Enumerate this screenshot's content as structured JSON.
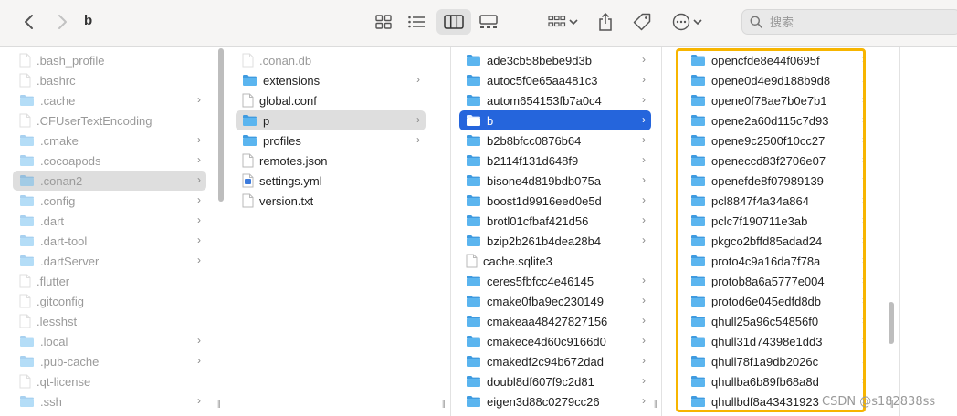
{
  "window": {
    "title": "b"
  },
  "toolbar": {
    "search_placeholder": "搜索"
  },
  "watermark": "CSDN @s182838ss",
  "col1": [
    {
      "label": ".bash_profile",
      "type": "doc",
      "hidden": true
    },
    {
      "label": ".bashrc",
      "type": "doc",
      "hidden": true
    },
    {
      "label": ".cache",
      "type": "folder",
      "hidden": true,
      "chevron": true
    },
    {
      "label": ".CFUserTextEncoding",
      "type": "doc",
      "hidden": true
    },
    {
      "label": ".cmake",
      "type": "folder",
      "hidden": true,
      "chevron": true
    },
    {
      "label": ".cocoapods",
      "type": "folder",
      "hidden": true,
      "chevron": true
    },
    {
      "label": ".conan2",
      "type": "folder",
      "hidden": true,
      "chevron": true,
      "selected": "gray"
    },
    {
      "label": ".config",
      "type": "folder",
      "hidden": true,
      "chevron": true
    },
    {
      "label": ".dart",
      "type": "folder",
      "hidden": true,
      "chevron": true
    },
    {
      "label": ".dart-tool",
      "type": "folder",
      "hidden": true,
      "chevron": true
    },
    {
      "label": ".dartServer",
      "type": "folder",
      "hidden": true,
      "chevron": true
    },
    {
      "label": ".flutter",
      "type": "doc",
      "hidden": true
    },
    {
      "label": ".gitconfig",
      "type": "doc",
      "hidden": true
    },
    {
      "label": ".lesshst",
      "type": "doc",
      "hidden": true
    },
    {
      "label": ".local",
      "type": "folder",
      "hidden": true,
      "chevron": true
    },
    {
      "label": ".pub-cache",
      "type": "folder",
      "hidden": true,
      "chevron": true
    },
    {
      "label": ".qt-license",
      "type": "doc",
      "hidden": true
    },
    {
      "label": ".ssh",
      "type": "folder",
      "hidden": true,
      "chevron": true
    }
  ],
  "col2": [
    {
      "label": ".conan.db",
      "type": "doc",
      "hidden": true
    },
    {
      "label": "extensions",
      "type": "folder",
      "chevron": true
    },
    {
      "label": "global.conf",
      "type": "doc"
    },
    {
      "label": "p",
      "type": "folder",
      "chevron": true,
      "selected": "gray"
    },
    {
      "label": "profiles",
      "type": "folder",
      "chevron": true
    },
    {
      "label": "remotes.json",
      "type": "doc"
    },
    {
      "label": "settings.yml",
      "type": "yml"
    },
    {
      "label": "version.txt",
      "type": "doc"
    }
  ],
  "col3": [
    {
      "label": "ade3cb58bebe9d3b",
      "type": "folder",
      "chevron": true
    },
    {
      "label": "autoc5f0e65aa481c3",
      "type": "folder",
      "chevron": true
    },
    {
      "label": "autom654153fb7a0c4",
      "type": "folder",
      "chevron": true
    },
    {
      "label": "b",
      "type": "folder",
      "chevron": true,
      "selected": "blue"
    },
    {
      "label": "b2b8bfcc0876b64",
      "type": "folder",
      "chevron": true
    },
    {
      "label": "b2114f131d648f9",
      "type": "folder",
      "chevron": true
    },
    {
      "label": "bisone4d819bdb075a",
      "type": "folder",
      "chevron": true
    },
    {
      "label": "boost1d9916eed0e5d",
      "type": "folder",
      "chevron": true
    },
    {
      "label": "brotl01cfbaf421d56",
      "type": "folder",
      "chevron": true
    },
    {
      "label": "bzip2b261b4dea28b4",
      "type": "folder",
      "chevron": true
    },
    {
      "label": "cache.sqlite3",
      "type": "doc"
    },
    {
      "label": "ceres5fbfcc4e46145",
      "type": "folder",
      "chevron": true
    },
    {
      "label": "cmake0fba9ec230149",
      "type": "folder",
      "chevron": true
    },
    {
      "label": "cmakeaa48427827156",
      "type": "folder",
      "chevron": true
    },
    {
      "label": "cmakece4d60c9166d0",
      "type": "folder",
      "chevron": true
    },
    {
      "label": "cmakedf2c94b672dad",
      "type": "folder",
      "chevron": true
    },
    {
      "label": "doubl8df607f9c2d81",
      "type": "folder",
      "chevron": true
    },
    {
      "label": "eigen3d88c0279cc26",
      "type": "folder",
      "chevron": true
    }
  ],
  "col4": [
    {
      "label": "opencfde8e44f0695f",
      "type": "folder",
      "chevron": true
    },
    {
      "label": "opene0d4e9d188b9d8",
      "type": "folder",
      "chevron": true
    },
    {
      "label": "opene0f78ae7b0e7b1",
      "type": "folder",
      "chevron": true
    },
    {
      "label": "opene2a60d115c7d93",
      "type": "folder",
      "chevron": true
    },
    {
      "label": "opene9c2500f10cc27",
      "type": "folder",
      "chevron": true
    },
    {
      "label": "openeccd83f2706e07",
      "type": "folder",
      "chevron": true
    },
    {
      "label": "openefde8f07989139",
      "type": "folder",
      "chevron": true
    },
    {
      "label": "pcl8847f4a34a864",
      "type": "folder",
      "chevron": true
    },
    {
      "label": "pclc7f190711e3ab",
      "type": "folder",
      "chevron": true
    },
    {
      "label": "pkgco2bffd85adad24",
      "type": "folder",
      "chevron": true
    },
    {
      "label": "proto4c9a16da7f78a",
      "type": "folder",
      "chevron": true
    },
    {
      "label": "protob8a6a5777e004",
      "type": "folder",
      "chevron": true
    },
    {
      "label": "protod6e045edfd8db",
      "type": "folder",
      "chevron": true
    },
    {
      "label": "qhull25a96c54856f0",
      "type": "folder",
      "chevron": true
    },
    {
      "label": "qhull31d74398e1dd3",
      "type": "folder",
      "chevron": true
    },
    {
      "label": "qhull78f1a9db2026c",
      "type": "folder",
      "chevron": true
    },
    {
      "label": "qhullba6b89fb68a8d",
      "type": "folder",
      "chevron": true
    },
    {
      "label": "qhullbdf8a43431923",
      "type": "folder",
      "chevron": true
    }
  ]
}
